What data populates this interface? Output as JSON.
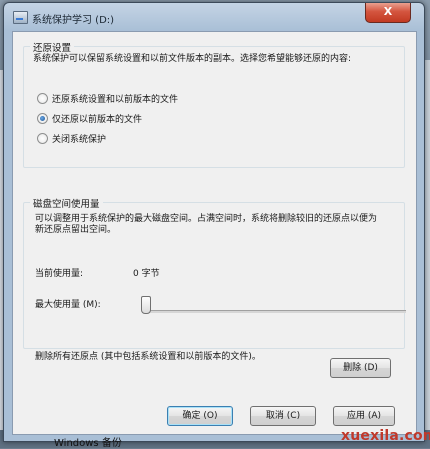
{
  "window": {
    "title": "系统保护学习 (D:)",
    "close_label": "X"
  },
  "restore_settings": {
    "title": "还原设置",
    "description": "系统保护可以保留系统设置和以前文件版本的副本。选择您希望能够还原的内容:",
    "options": [
      {
        "label": "还原系统设置和以前版本的文件",
        "checked": false
      },
      {
        "label": "仅还原以前版本的文件",
        "checked": true
      },
      {
        "label": "关闭系统保护",
        "checked": false
      }
    ]
  },
  "disk_space": {
    "title": "磁盘空间使用量",
    "description": "可以调整用于系统保护的最大磁盘空间。占满空间时，系统将删除较旧的还原点以便为新还原点留出空间。",
    "current_usage_label": "当前使用量:",
    "current_usage_value": "0 字节",
    "max_usage_label": "最大使用量 (M):",
    "max_usage_fraction": 0.0
  },
  "delete_section": {
    "text": "删除所有还原点 (其中包括系统设置和以前版本的文件)。",
    "delete_button": "删除 (D)"
  },
  "buttons": {
    "ok": "确定 (O)",
    "cancel": "取消 (C)",
    "apply": "应用 (A)"
  },
  "background": {
    "taskbar_text": "Windows 备份"
  },
  "watermark": "xuexila.com",
  "colors": {
    "accent": "#3a7bd5",
    "close": "#c23a22",
    "watermark": "#c0392b"
  }
}
